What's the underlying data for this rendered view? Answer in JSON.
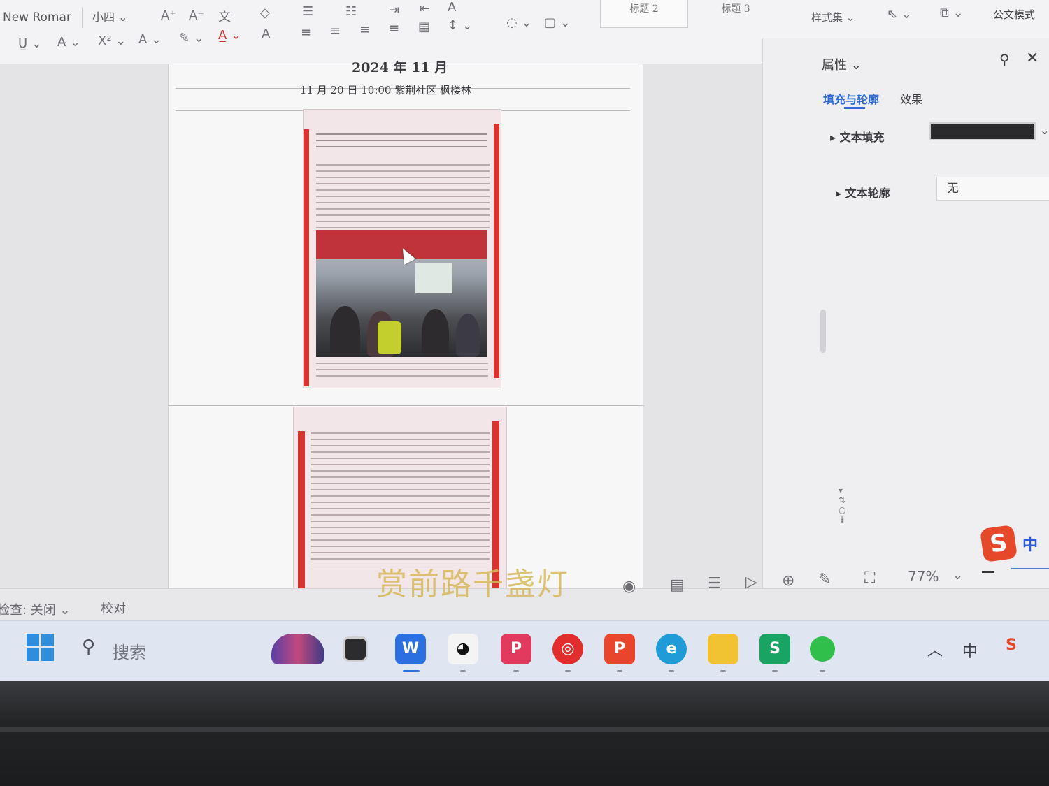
{
  "ribbon": {
    "font_name": "New Romar",
    "font_size": "小四",
    "style_tiles": [
      "标题 2",
      "标题 3"
    ],
    "style_set_label": "样式集",
    "doc_mode_label": "公文模式"
  },
  "document": {
    "header_date": "2024 年 11 月",
    "header_detail": "11 月 20 日 10:00  紫荆社区  枫楼林"
  },
  "panel": {
    "title": "属性",
    "tabs": [
      "填充与轮廓",
      "效果"
    ],
    "text_fill_label": "文本填充",
    "text_outline_label": "文本轮廓",
    "text_outline_value": "无"
  },
  "statusbar": {
    "check_label": "检查: 关闭",
    "proof_label": "校对",
    "zoom": "77%",
    "overlay_caption": "赏前路千盏灯"
  },
  "taskbar": {
    "search_placeholder": "搜索",
    "apps": [
      "widgets",
      "task-view",
      "wps-writer",
      "qq",
      "pdf-tool",
      "netease-music",
      "wps-presentation",
      "edge-ai",
      "file-explorer",
      "wps-spreadsheet",
      "wechat"
    ],
    "ime_indicator": "中"
  },
  "ime_badge": {
    "logo": "S",
    "mode": "中"
  }
}
